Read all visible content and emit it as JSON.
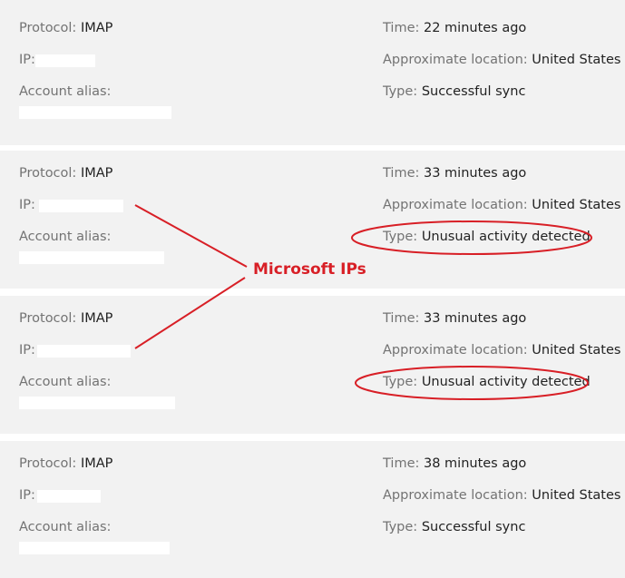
{
  "labels": {
    "protocol": "Protocol:",
    "ip": "IP:",
    "account_alias": "Account alias:",
    "time": "Time:",
    "location": "Approximate location:",
    "type": "Type:"
  },
  "entries": [
    {
      "protocol": "IMAP",
      "time": "22 minutes ago",
      "location": "United States",
      "type": "Successful sync"
    },
    {
      "protocol": "IMAP",
      "time": "33 minutes ago",
      "location": "United States",
      "type": "Unusual activity detected"
    },
    {
      "protocol": "IMAP",
      "time": "33 minutes ago",
      "location": "United States",
      "type": "Unusual activity detected"
    },
    {
      "protocol": "IMAP",
      "time": "38 minutes ago",
      "location": "United States",
      "type": "Successful sync"
    }
  ],
  "annotation": {
    "text": "Microsoft IPs",
    "color": "#d81f26"
  },
  "colors": {
    "card_bg": "#f2f2f2",
    "label": "#737373",
    "value": "#222222"
  }
}
